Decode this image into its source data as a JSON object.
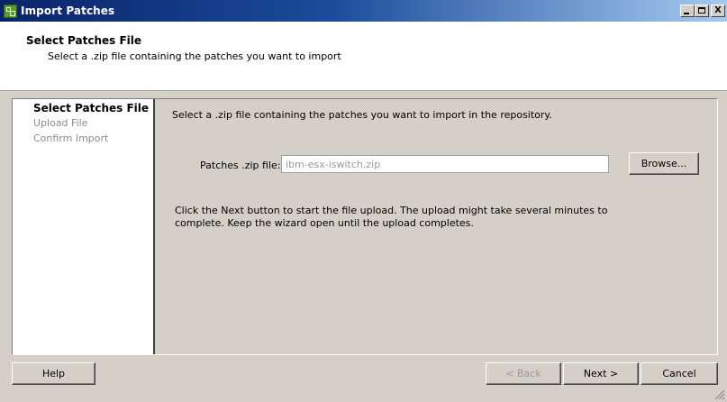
{
  "window": {
    "title": "Import Patches",
    "controls": {
      "minimize": "",
      "maximize": "",
      "close": "X"
    }
  },
  "header": {
    "title": "Select Patches File",
    "subtitle": "Select a .zip file containing the patches you want to import"
  },
  "steps": [
    {
      "label": "Select Patches File",
      "active": true
    },
    {
      "label": "Upload File",
      "active": false
    },
    {
      "label": "Confirm Import",
      "active": false
    }
  ],
  "main": {
    "intro": "Select a .zip file containing the patches you want to import in the repository.",
    "file_label": "Patches .zip file:",
    "file_value": "ibm-esx-iswitch.zip",
    "browse_label": "Browse...",
    "note": "Click the Next button to start the file upload. The upload might take several minutes to complete. Keep the wizard open until the upload completes."
  },
  "footer": {
    "help_label": "Help",
    "back_label": "< Back",
    "next_label": "Next >",
    "cancel_label": "Cancel"
  },
  "colors": {
    "title_bar": "#0a246a",
    "dialog_face": "#d4d0c8",
    "disabled_text": "#8c8c8c"
  },
  "icons": [
    "patches-app-icon",
    "minimize-icon",
    "maximize-icon",
    "close-icon",
    "resize-grip-icon"
  ]
}
